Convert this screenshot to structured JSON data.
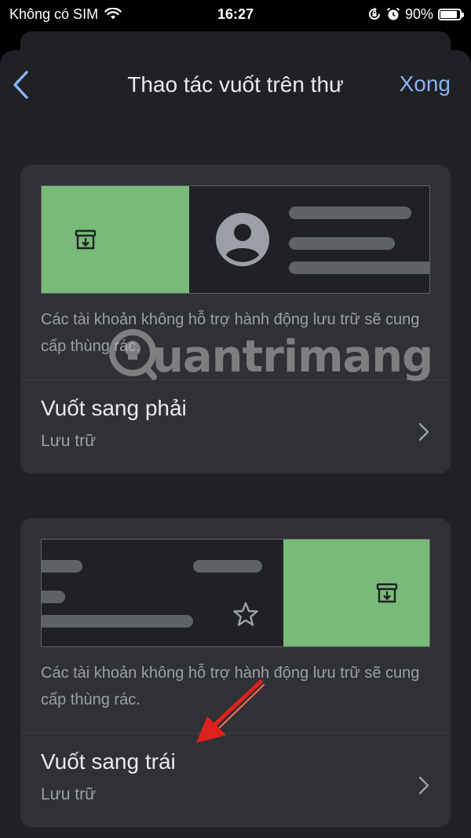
{
  "status_bar": {
    "carrier": "Không có SIM",
    "time": "16:27",
    "battery": "90%"
  },
  "nav": {
    "title": "Thao tác vuốt trên thư",
    "done_label": "Xong"
  },
  "swipe_right": {
    "note": "Các tài khoản không hỗ trợ hành động lưu trữ sẽ cung cấp thùng rác.",
    "title": "Vuốt sang phải",
    "action": "Lưu trữ"
  },
  "swipe_left": {
    "note": "Các tài khoản không hỗ trợ hành động lưu trữ sẽ cung cấp thùng rác.",
    "title": "Vuốt sang trái",
    "action": "Lưu trữ"
  },
  "watermark": {
    "text": "uantrimang"
  },
  "colors": {
    "accent": "#8ab4f8",
    "swipe_green": "#78ba78",
    "annotation_red": "#e0201c"
  }
}
